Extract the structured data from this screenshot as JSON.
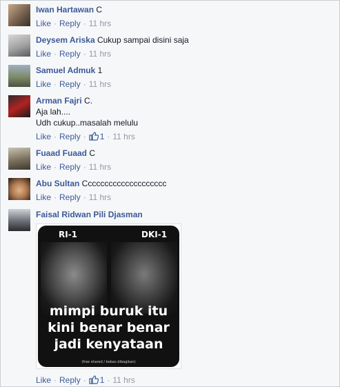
{
  "actions": {
    "like": "Like",
    "reply": "Reply",
    "dot": "·"
  },
  "comments": [
    {
      "author": "Iwan Hartawan",
      "text": "C",
      "time": "11 hrs"
    },
    {
      "author": "Deysem Ariska",
      "text": "Cukup sampai disini saja",
      "time": "11 hrs"
    },
    {
      "author": "Samuel Admuk",
      "text": "1",
      "time": "11 hrs"
    },
    {
      "author": "Arman Fajri",
      "text": "C.",
      "text2": "Aja lah....",
      "text3": "Udh cukup..masalah melulu",
      "likes": "1",
      "time": "11 hrs"
    },
    {
      "author": "Fuaad Fuaad",
      "text": "C",
      "time": "11 hrs"
    },
    {
      "author": "Abu Sultan",
      "text": "Cccccccccccccccccccc",
      "time": "11 hrs"
    },
    {
      "author": "Faisal Ridwan Pili Djasman",
      "text": "",
      "likes": "1",
      "time": "11 hrs"
    }
  ],
  "poster": {
    "label_left": "RI-1",
    "label_right": "DKI-1",
    "line1": "mimpi buruk itu",
    "line2": "kini benar benar",
    "line3": "jadi kenyataan",
    "footnote": "(free shared / bebas dibagikan)"
  },
  "colors": {
    "link": "#3b5998",
    "meta": "#9197a3",
    "text": "#141823",
    "background": "#f6f7f9"
  }
}
